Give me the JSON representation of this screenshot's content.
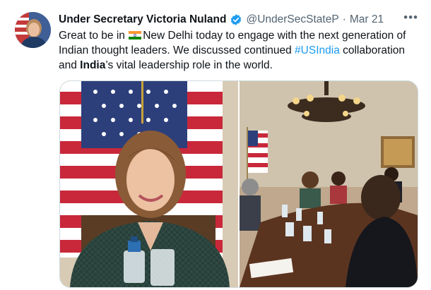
{
  "tweet": {
    "author_name": "Under Secretary Victoria Nuland",
    "handle": "@UnderSecStateP",
    "separator": "·",
    "date": "Mar 21",
    "more_icon": "more-horizontal-icon",
    "verified_icon": "verified-badge-icon",
    "text": {
      "part1": "Great to be in ",
      "part2": "New Delhi today to engage with the next generation of Indian thought leaders. We discussed continued ",
      "hashtag": "#USIndia",
      "part3": " collaboration and ",
      "bold": "India",
      "part4": "’s vital leadership role in the world."
    },
    "colors": {
      "link": "#1d9bf0",
      "verified": "#1d9bf0",
      "muted": "#536471"
    }
  }
}
